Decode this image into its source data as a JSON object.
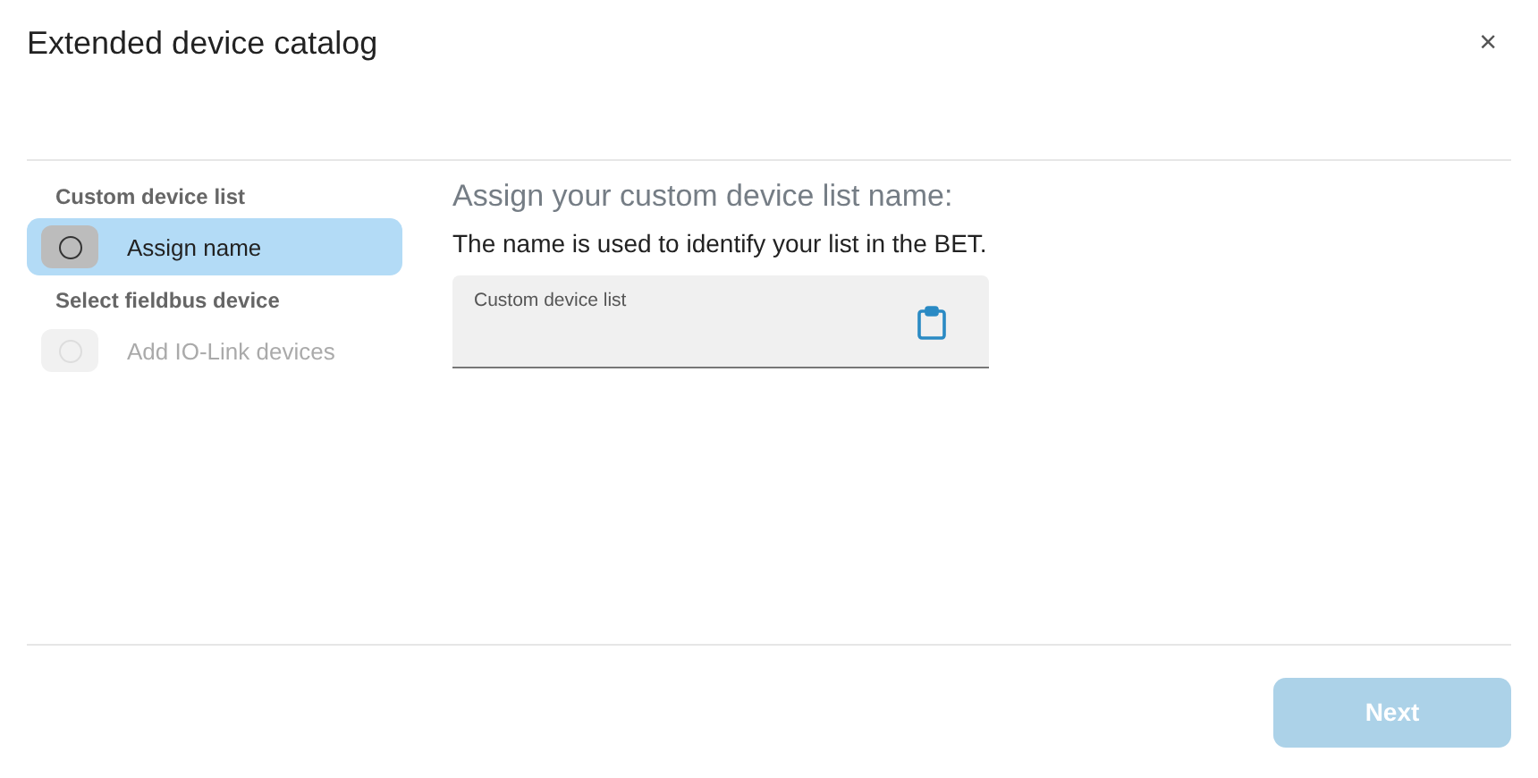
{
  "dialog": {
    "title": "Extended device catalog",
    "close": "×"
  },
  "steps": [
    {
      "heading": "Custom device list",
      "items": [
        {
          "label": "Assign name",
          "selected": true,
          "disabled": false
        }
      ]
    },
    {
      "heading": "Select fieldbus device",
      "items": [
        {
          "label": "Add IO-Link devices",
          "selected": false,
          "disabled": true
        }
      ]
    }
  ],
  "content": {
    "heading": "Assign your custom device list name:",
    "description": "The name is used to identify your list in the BET.",
    "field": {
      "label": "Custom device list"
    }
  },
  "footer": {
    "button": {
      "label": "Next",
      "disabled": true
    }
  }
}
